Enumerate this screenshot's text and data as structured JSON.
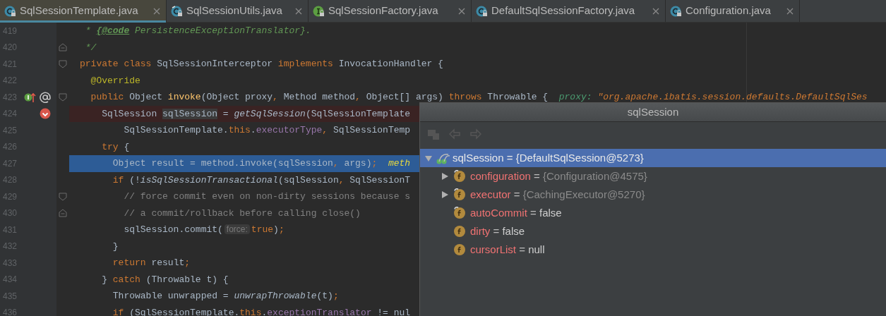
{
  "tabs": [
    {
      "label": "SqlSessionTemplate.java",
      "kind": "class",
      "selected": true
    },
    {
      "label": "SqlSessionUtils.java",
      "kind": "final-class",
      "selected": false
    },
    {
      "label": "SqlSessionFactory.java",
      "kind": "interface",
      "selected": false
    },
    {
      "label": "DefaultSqlSessionFactory.java",
      "kind": "class",
      "selected": false
    },
    {
      "label": "Configuration.java",
      "kind": "class",
      "selected": false
    }
  ],
  "editor": {
    "lines": [
      {
        "number": "419",
        "kind": "normal",
        "tokens": [
          {
            "kind": "doc",
            "text": " * "
          },
          {
            "kind": "doctag",
            "text": "{@code"
          },
          {
            "kind": "doc",
            "text": " PersistenceExceptionTranslator}."
          }
        ]
      },
      {
        "number": "420",
        "kind": "normal",
        "gutter": [
          {
            "kind": "fold-end"
          }
        ],
        "tokens": [
          {
            "kind": "doc",
            "text": " */"
          }
        ]
      },
      {
        "number": "421",
        "kind": "normal",
        "gutter": [
          {
            "kind": "fold-start"
          }
        ],
        "tokens": [
          {
            "kind": "kw",
            "text": "private class "
          },
          {
            "kind": "plain",
            "text": "SqlSessionInterceptor "
          },
          {
            "kind": "kw",
            "text": "implements "
          },
          {
            "kind": "plain",
            "text": "InvocationHandler {"
          }
        ]
      },
      {
        "number": "422",
        "kind": "normal",
        "tokens": [
          {
            "kind": "ann",
            "text": "  @Override"
          }
        ]
      },
      {
        "number": "423",
        "kind": "normal",
        "gutter": [
          {
            "kind": "implements"
          },
          {
            "kind": "annotation"
          },
          {
            "kind": "fold-start"
          }
        ],
        "tokens": [
          {
            "kind": "kw",
            "text": "  public "
          },
          {
            "kind": "plain",
            "text": "Object "
          },
          {
            "kind": "fn",
            "text": "invoke"
          },
          {
            "kind": "plain",
            "text": "(Object proxy"
          },
          {
            "kind": "kw",
            "text": ", "
          },
          {
            "kind": "plain",
            "text": "Method method"
          },
          {
            "kind": "kw",
            "text": ", "
          },
          {
            "kind": "plain",
            "text": "Object[] args) "
          },
          {
            "kind": "kw",
            "text": "throws "
          },
          {
            "kind": "plain",
            "text": "Throwable {  "
          },
          {
            "kind": "dbgname",
            "text": "proxy: "
          },
          {
            "kind": "dbgvalue",
            "text": "\"org.apache.ibatis.session.defaults.DefaultSqlSes"
          }
        ]
      },
      {
        "number": "424",
        "kind": "breakpoint",
        "gutter": [
          {
            "kind": "breakpoint"
          }
        ],
        "tokens": [
          {
            "kind": "plain",
            "text": "    SqlSession "
          },
          {
            "kind": "usage",
            "text": "sqlSession"
          },
          {
            "kind": "plain",
            "text": " = "
          },
          {
            "kind": "italic",
            "text": "getSqlSession"
          },
          {
            "kind": "plain",
            "text": "(SqlSessionTemplate"
          }
        ]
      },
      {
        "number": "425",
        "kind": "normal",
        "tokens": [
          {
            "kind": "plain",
            "text": "        SqlSessionTemplate."
          },
          {
            "kind": "kw",
            "text": "this"
          },
          {
            "kind": "plain",
            "text": "."
          },
          {
            "kind": "field",
            "text": "executorType"
          },
          {
            "kind": "kw",
            "text": ", "
          },
          {
            "kind": "plain",
            "text": "SqlSessionTemp"
          }
        ]
      },
      {
        "number": "426",
        "kind": "normal",
        "tokens": [
          {
            "kind": "kw",
            "text": "    try "
          },
          {
            "kind": "plain",
            "text": "{"
          }
        ]
      },
      {
        "number": "427",
        "kind": "execution",
        "tokens": [
          {
            "kind": "plain",
            "text": "      Object result = method.invoke(sqlSession"
          },
          {
            "kind": "kw",
            "text": ", "
          },
          {
            "kind": "plain",
            "text": "args)"
          },
          {
            "kind": "kw",
            "text": ";  "
          },
          {
            "kind": "dbginline",
            "text": "meth"
          }
        ]
      },
      {
        "number": "428",
        "kind": "normal",
        "tokens": [
          {
            "kind": "kw",
            "text": "      if "
          },
          {
            "kind": "plain",
            "text": "(!"
          },
          {
            "kind": "italic",
            "text": "isSqlSessionTransactional"
          },
          {
            "kind": "plain",
            "text": "(sqlSession"
          },
          {
            "kind": "kw",
            "text": ", "
          },
          {
            "kind": "plain",
            "text": "SqlSessionT"
          }
        ]
      },
      {
        "number": "429",
        "kind": "normal",
        "gutter": [
          {
            "kind": "fold-start"
          }
        ],
        "tokens": [
          {
            "kind": "comment",
            "text": "        // force commit even on non-dirty sessions because s"
          }
        ]
      },
      {
        "number": "430",
        "kind": "normal",
        "gutter": [
          {
            "kind": "fold-end"
          }
        ],
        "tokens": [
          {
            "kind": "comment",
            "text": "        // a commit/rollback before calling close()"
          }
        ]
      },
      {
        "number": "431",
        "kind": "normal",
        "tokens": [
          {
            "kind": "plain",
            "text": "        sqlSession.commit("
          },
          {
            "kind": "hint",
            "text": "force:"
          },
          {
            "kind": "kw",
            "text": "true"
          },
          {
            "kind": "plain",
            "text": ")"
          },
          {
            "kind": "kw",
            "text": ";"
          }
        ]
      },
      {
        "number": "432",
        "kind": "normal",
        "tokens": [
          {
            "kind": "plain",
            "text": "      }"
          }
        ]
      },
      {
        "number": "433",
        "kind": "normal",
        "tokens": [
          {
            "kind": "kw",
            "text": "      return "
          },
          {
            "kind": "plain",
            "text": "result"
          },
          {
            "kind": "kw",
            "text": ";"
          }
        ]
      },
      {
        "number": "434",
        "kind": "normal",
        "tokens": [
          {
            "kind": "plain",
            "text": "    } "
          },
          {
            "kind": "kw",
            "text": "catch "
          },
          {
            "kind": "plain",
            "text": "(Throwable t) {"
          }
        ]
      },
      {
        "number": "435",
        "kind": "normal",
        "tokens": [
          {
            "kind": "plain",
            "text": "      Throwable unwrapped = "
          },
          {
            "kind": "italic",
            "text": "unwrapThrowable"
          },
          {
            "kind": "plain",
            "text": "(t)"
          },
          {
            "kind": "kw",
            "text": ";"
          }
        ]
      },
      {
        "number": "436",
        "kind": "normal",
        "tokens": [
          {
            "kind": "kw",
            "text": "      if "
          },
          {
            "kind": "plain",
            "text": "(SqlSessionTemplate."
          },
          {
            "kind": "kw",
            "text": "this"
          },
          {
            "kind": "plain",
            "text": "."
          },
          {
            "kind": "field",
            "text": "exceptionTranslator"
          },
          {
            "kind": "plain",
            "text": " != nul"
          }
        ]
      }
    ]
  },
  "popup": {
    "title": "sqlSession",
    "root": {
      "name": "sqlSession",
      "operator": "=",
      "value": "{DefaultSqlSession@5273}",
      "expanded": true,
      "selected": true,
      "children": [
        {
          "name": "configuration",
          "operator": "=",
          "value": "{Configuration@4575}",
          "kind": "object",
          "final": true
        },
        {
          "name": "executor",
          "operator": "=",
          "value": "{CachingExecutor@5270}",
          "kind": "object",
          "final": true
        },
        {
          "name": "autoCommit",
          "operator": "=",
          "value": "false",
          "kind": "primitive",
          "final": true
        },
        {
          "name": "dirty",
          "operator": "=",
          "value": "false",
          "kind": "primitive",
          "final": false
        },
        {
          "name": "cursorList",
          "operator": "=",
          "value": "null",
          "kind": "primitive",
          "final": false
        }
      ]
    }
  }
}
